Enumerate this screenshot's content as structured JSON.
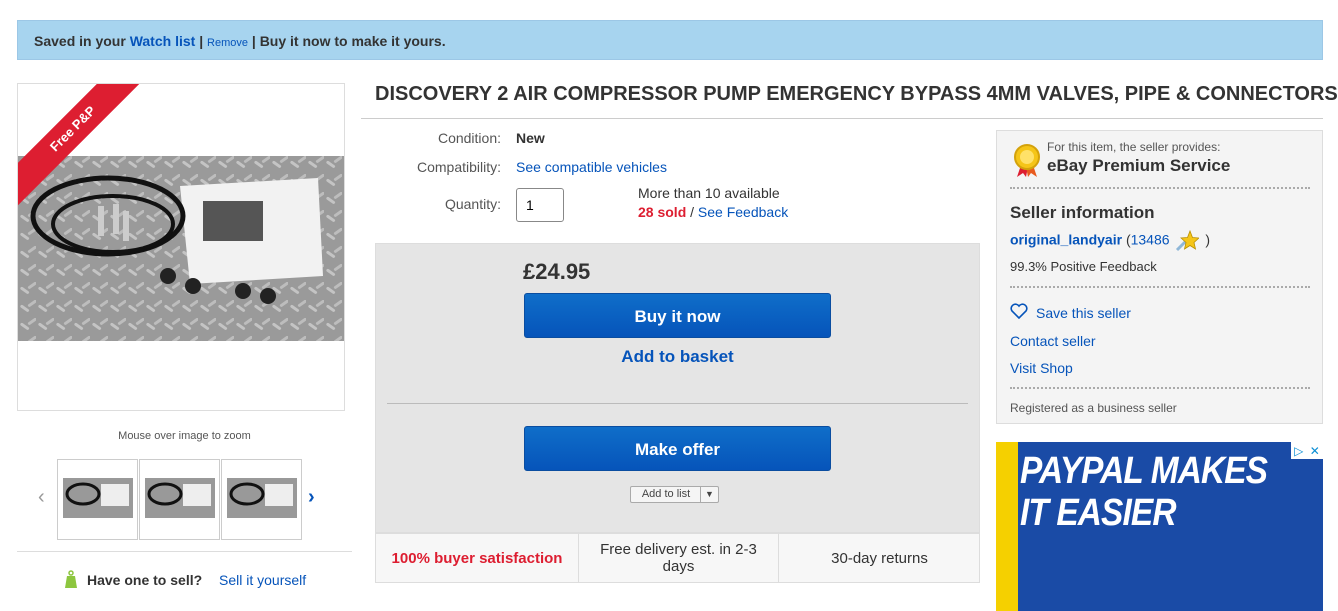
{
  "banner": {
    "saved_prefix": "Saved in your",
    "watch_list": "Watch list",
    "sep1": "|",
    "remove": "Remove",
    "sep2": "|",
    "buy_msg": "Buy it now to make it yours."
  },
  "gallery": {
    "ribbon": "Free P&P",
    "zoom_hint": "Mouse over image to zoom",
    "have_one": "Have one to sell?",
    "sell_it": "Sell it yourself"
  },
  "item": {
    "title": "DISCOVERY 2 AIR COMPRESSOR PUMP EMERGENCY BYPASS 4MM VALVES, PIPE & CONNECTORS",
    "condition_label": "Condition:",
    "condition_value": "New",
    "compat_label": "Compatibility:",
    "compat_link": "See compatible vehicles",
    "quantity_label": "Quantity:",
    "quantity_value": "1",
    "available": "More than 10 available",
    "sold": "28 sold",
    "sold_sep": "/",
    "feedback_link": "See Feedback"
  },
  "buy": {
    "price": "£24.95",
    "buy_now": "Buy it now",
    "add_basket": "Add to basket",
    "make_offer": "Make offer",
    "add_list": "Add to list"
  },
  "features": {
    "satisfaction": "100% buyer satisfaction",
    "delivery": "Free delivery est. in 2-3 days",
    "returns": "30-day returns"
  },
  "seller": {
    "provides": "For this item, the seller provides:",
    "premium": "eBay Premium Service",
    "heading": "Seller information",
    "name": "original_landyair",
    "open_paren": "(",
    "score": "13486",
    "close_paren": ")",
    "positive": "99.3% Positive Feedback",
    "save": "Save this seller",
    "contact": "Contact seller",
    "shop": "Visit Shop",
    "registered": "Registered as a business seller"
  },
  "ad": {
    "line1": "PAYPAL MAKES",
    "line2": "IT EASIER"
  },
  "colors": {
    "accent_blue": "#0654ba",
    "banner_bg": "#a7d4ef",
    "ribbon_red": "#dd1e31"
  }
}
